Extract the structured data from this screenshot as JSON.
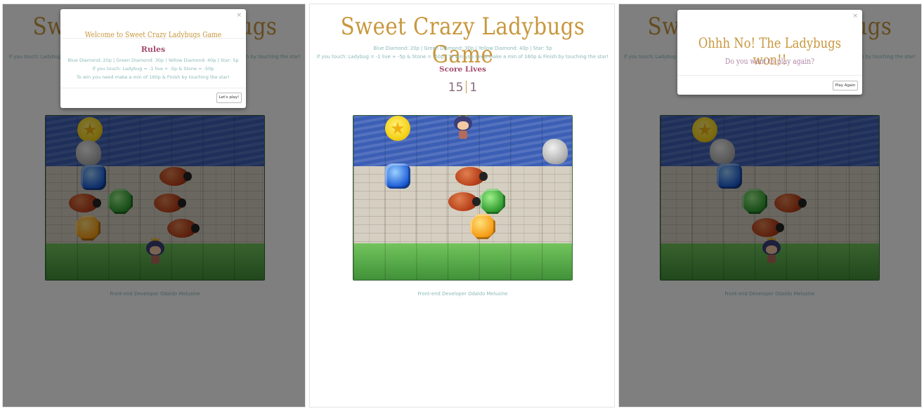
{
  "game": {
    "title": "Sweet Crazy Ladybugs Game",
    "rules_line1": "Blue Diamond: 20p | Green Diamond: 30p | Yellow Diamond: 40p | Star: 5p",
    "rules_line2": "If you touch: Ladybug = -1 live + -5p & Stone = -50p | To win you need make a min of 160p & Finish by touching the star!",
    "score_label": "Score Lives",
    "score": "15",
    "lives": "1",
    "footer": "Front-end Developer Odaldo Melusine"
  },
  "welcome_modal": {
    "title": "Welcome to Sweet Crazy Ladybugs Game",
    "close": "×",
    "rules_heading": "Rules",
    "line1": "Blue Diamond: 20p | Green Diamond: 30p | Yellow Diamond: 40p | Star: 5p",
    "line2": "If you touch: Ladybug = -1 live + -5p & Stone = -50p",
    "line3": "To win you need make a min of 160p & Finish by touching the star!",
    "button": "Let's play!"
  },
  "lose_modal": {
    "title": "Ohhh No! The Ladybugs won!!",
    "close": "×",
    "subtitle": "Do you want to play again?",
    "button": "Play Again"
  }
}
